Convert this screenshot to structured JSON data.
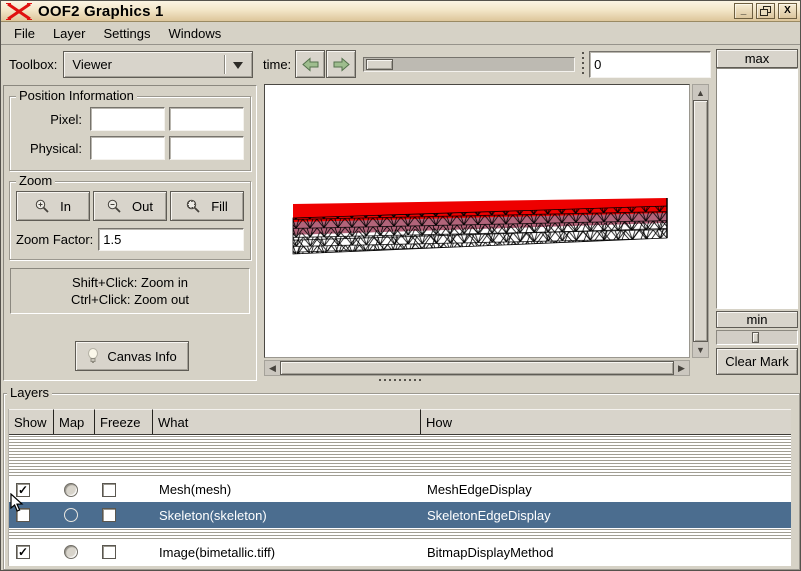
{
  "window": {
    "title": "OOF2 Graphics 1",
    "minimize_glyph": "_",
    "close_glyph": "X"
  },
  "menu": {
    "items": [
      {
        "label": "File"
      },
      {
        "label": "Layer"
      },
      {
        "label": "Settings"
      },
      {
        "label": "Windows"
      }
    ]
  },
  "toolbox": {
    "label": "Toolbox:",
    "selected": "Viewer"
  },
  "position_info": {
    "legend": "Position Information",
    "pixel_label": "Pixel:",
    "physical_label": "Physical:",
    "pixel_x": "",
    "pixel_y": "",
    "physical_x": "",
    "physical_y": ""
  },
  "zoom": {
    "legend": "Zoom",
    "in_label": "In",
    "out_label": "Out",
    "fill_label": "Fill",
    "factor_label": "Zoom Factor:",
    "factor_value": "1.5",
    "hint_line1": "Shift+Click: Zoom in",
    "hint_line2": "Ctrl+Click: Zoom out"
  },
  "canvas_info_label": "Canvas Info",
  "timebar": {
    "label": "time:",
    "value": "0"
  },
  "colorbar": {
    "max_label": "max",
    "min_label": "min",
    "clear_button_label": "Clear Mark"
  },
  "layers": {
    "legend": "Layers",
    "columns": [
      {
        "label": "Show"
      },
      {
        "label": "Map"
      },
      {
        "label": "Freeze"
      },
      {
        "label": "What"
      },
      {
        "label": "How"
      }
    ],
    "rows": [
      {
        "show_glyph": "✓",
        "what": "Mesh(mesh)",
        "how": "MeshEdgeDisplay",
        "selected": false
      },
      {
        "show_glyph": "",
        "what": "Skeleton(skeleton)",
        "how": "SkeletonEdgeDisplay",
        "selected": true
      },
      {
        "show_glyph": "✓",
        "what": "Image(bimetallic.tiff)",
        "how": "BitmapDisplayMethod",
        "selected": false
      }
    ]
  },
  "colors": {
    "selection": "#4b6d8f",
    "titlebar_top": "#fbf4e3",
    "titlebar_bottom": "#ddc69b",
    "mesh_red": "#ee0000",
    "mesh_pink": "#b2647a",
    "arrow_green": "#9ebd8e"
  }
}
